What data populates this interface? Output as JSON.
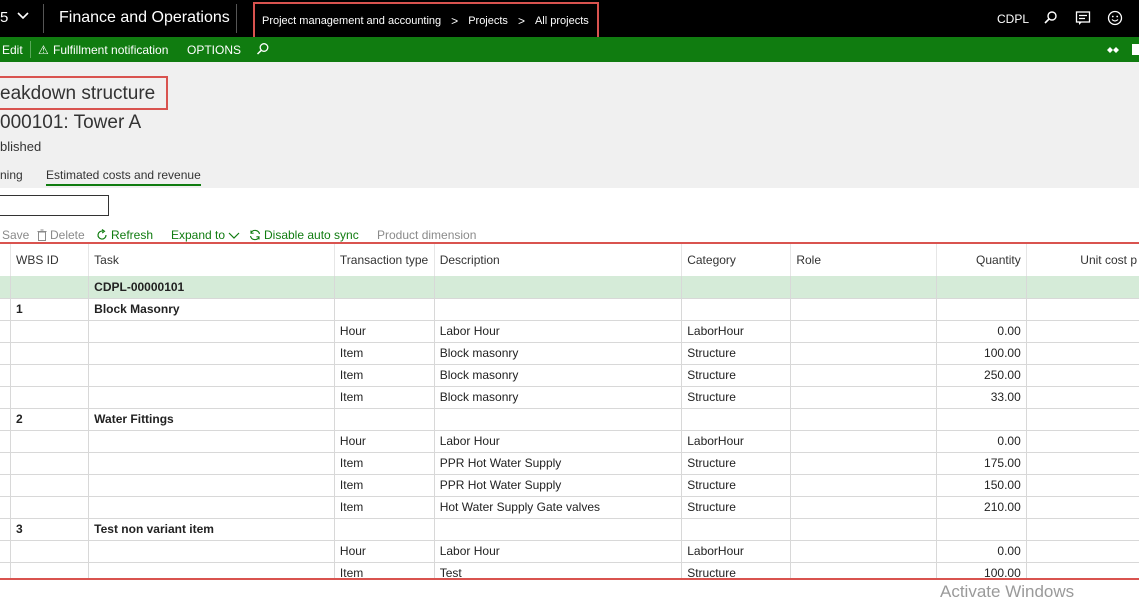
{
  "topbar": {
    "app_code": "5",
    "app_name": "Finance and Operations",
    "breadcrumbs": [
      "Project management and accounting",
      "Projects",
      "All projects"
    ],
    "company": "CDPL",
    "icons": [
      "search-icon",
      "chat-icon",
      "smiley-icon"
    ]
  },
  "actionbar": {
    "edit": "Edit",
    "fulfillment": "Fulfillment notification",
    "options": "OPTIONS"
  },
  "header": {
    "title": "eakdown structure",
    "subtitle": "000101: Tower A",
    "status": "blished",
    "tabs": [
      "ning",
      "Estimated costs and revenue"
    ]
  },
  "toolbar": {
    "save": "Save",
    "delete": "Delete",
    "refresh": "Refresh",
    "expand": "Expand to",
    "disable_sync": "Disable auto sync",
    "product_dimension": "Product dimension"
  },
  "grid": {
    "columns": [
      "WBS ID",
      "Task",
      "Transaction type",
      "Description",
      "Category",
      "Role",
      "Quantity",
      "Unit cost p"
    ],
    "rows": [
      {
        "type": "root",
        "wbs": "",
        "task": "CDPL-00000101",
        "tx": "",
        "desc": "",
        "cat": "",
        "role": "",
        "qty": ""
      },
      {
        "type": "task",
        "wbs": "1",
        "task": "Block Masonry",
        "tx": "",
        "desc": "",
        "cat": "",
        "role": "",
        "qty": ""
      },
      {
        "type": "line",
        "wbs": "",
        "task": "",
        "tx": "Hour",
        "desc": "Labor Hour",
        "cat": "LaborHour",
        "role": "",
        "qty": "0.00"
      },
      {
        "type": "line",
        "wbs": "",
        "task": "",
        "tx": "Item",
        "desc": "Block masonry",
        "cat": "Structure",
        "role": "",
        "qty": "100.00"
      },
      {
        "type": "line",
        "wbs": "",
        "task": "",
        "tx": "Item",
        "desc": "Block masonry",
        "cat": "Structure",
        "role": "",
        "qty": "250.00"
      },
      {
        "type": "line",
        "wbs": "",
        "task": "",
        "tx": "Item",
        "desc": "Block masonry",
        "cat": "Structure",
        "role": "",
        "qty": "33.00"
      },
      {
        "type": "task",
        "wbs": "2",
        "task": "Water Fittings",
        "tx": "",
        "desc": "",
        "cat": "",
        "role": "",
        "qty": ""
      },
      {
        "type": "line",
        "wbs": "",
        "task": "",
        "tx": "Hour",
        "desc": "Labor Hour",
        "cat": "LaborHour",
        "role": "",
        "qty": "0.00"
      },
      {
        "type": "line",
        "wbs": "",
        "task": "",
        "tx": "Item",
        "desc": "PPR Hot Water Supply",
        "cat": "Structure",
        "role": "",
        "qty": "175.00"
      },
      {
        "type": "line",
        "wbs": "",
        "task": "",
        "tx": "Item",
        "desc": "PPR Hot Water Supply",
        "cat": "Structure",
        "role": "",
        "qty": "150.00"
      },
      {
        "type": "line",
        "wbs": "",
        "task": "",
        "tx": "Item",
        "desc": "Hot Water Supply Gate valves",
        "cat": "Structure",
        "role": "",
        "qty": "210.00"
      },
      {
        "type": "task",
        "wbs": "3",
        "task": "Test non variant item",
        "tx": "",
        "desc": "",
        "cat": "",
        "role": "",
        "qty": ""
      },
      {
        "type": "line",
        "wbs": "",
        "task": "",
        "tx": "Hour",
        "desc": "Labor Hour",
        "cat": "LaborHour",
        "role": "",
        "qty": "0.00"
      },
      {
        "type": "line",
        "wbs": "",
        "task": "",
        "tx": "Item",
        "desc": "Test",
        "cat": "Structure",
        "role": "",
        "qty": "100.00"
      }
    ]
  },
  "watermark": "Activate Windows",
  "colors": {
    "green": "#107c10",
    "highlight": "#d9534f",
    "root_row": "#d5ebd8"
  }
}
